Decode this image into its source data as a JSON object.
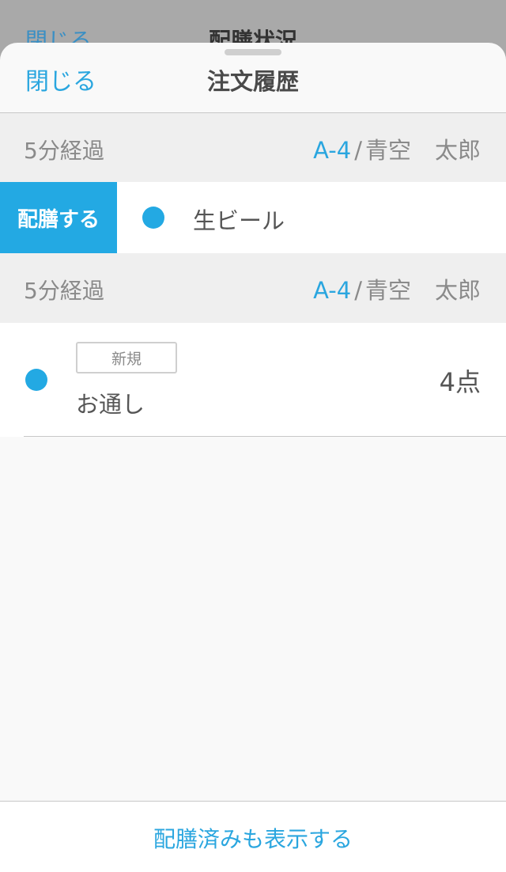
{
  "background_screen": {
    "close_label": "閉じる",
    "title": "配膳状況"
  },
  "sheet": {
    "close_label": "閉じる",
    "title": "注文履歴"
  },
  "orders": [
    {
      "elapsed": "5分経過",
      "table": "A-4",
      "separator": "/",
      "customer_last": "青空",
      "customer_first": "太郎",
      "serve_action": "配膳する",
      "item": "生ビール"
    },
    {
      "elapsed": "5分経過",
      "table": "A-4",
      "separator": "/",
      "customer_last": "青空",
      "customer_first": "太郎",
      "badge": "新規",
      "item": "お通し",
      "quantity": "4点"
    }
  ],
  "footer": {
    "show_served_label": "配膳済みも表示する"
  },
  "colors": {
    "accent": "#23a9e3",
    "text_primary": "#555555",
    "text_secondary": "#8a8a8a",
    "group_header_bg": "#efefef"
  }
}
